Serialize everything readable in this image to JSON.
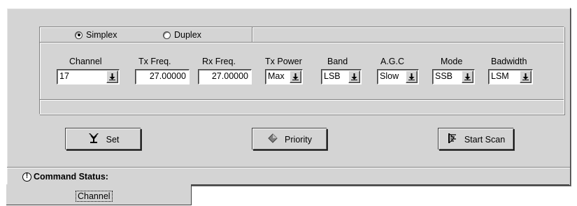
{
  "mode_selector": {
    "simplex_label": "Simplex",
    "duplex_label": "Duplex",
    "selected": "Simplex"
  },
  "fields": {
    "channel": {
      "label": "Channel",
      "value": "17"
    },
    "tx_freq": {
      "label": "Tx Freq.",
      "value": "27.00000"
    },
    "rx_freq": {
      "label": "Rx Freq.",
      "value": "27.00000"
    },
    "tx_power": {
      "label": "Tx Power",
      "value": "Max"
    },
    "band": {
      "label": "Band",
      "value": "LSB"
    },
    "agc": {
      "label": "A.G.C",
      "value": "Slow"
    },
    "mode": {
      "label": "Mode",
      "value": "SSB"
    },
    "bandwidth": {
      "label": "Badwidth",
      "value": "LSM"
    }
  },
  "buttons": {
    "set": "Set",
    "priority": "Priority",
    "start_scan": "Start Scan"
  },
  "status": {
    "label": "Command Status:",
    "value": ""
  },
  "tabs": [
    {
      "label": "Channel",
      "active": true
    }
  ],
  "icons": {
    "dropdown": "down-arrow-icon",
    "set": "antenna-icon",
    "priority": "diamond-icon",
    "start_scan": "scan-icon",
    "status": "exclamation-icon"
  }
}
